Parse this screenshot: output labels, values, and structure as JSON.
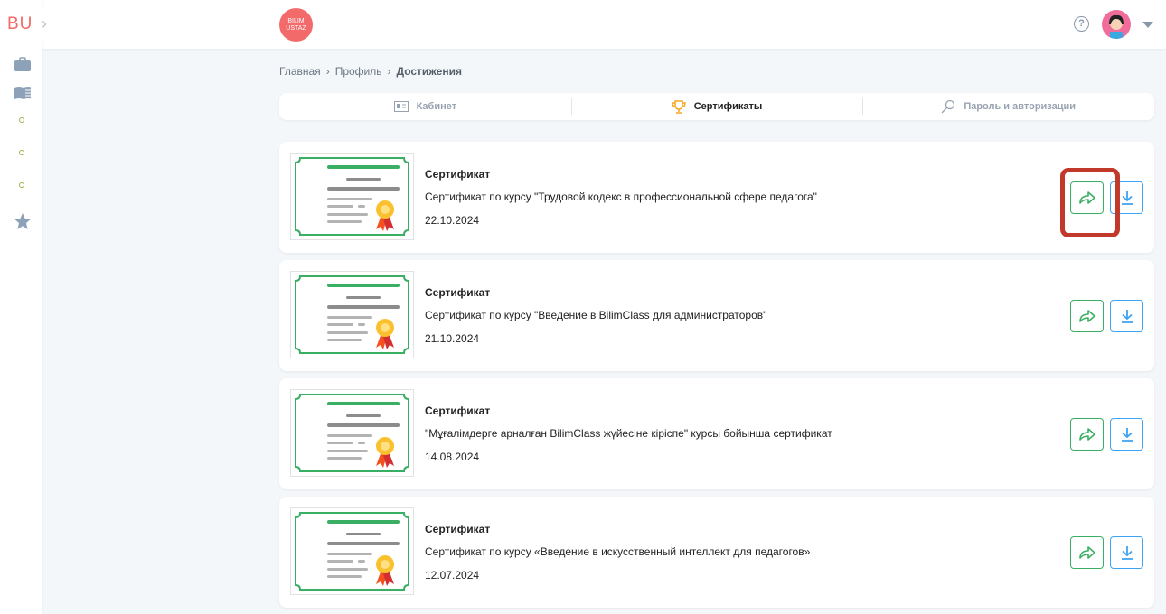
{
  "sidebar": {
    "logo": "BU",
    "expand": "›"
  },
  "header": {
    "brand_line1": "BILIM",
    "brand_line2": "USTAZ",
    "help": "?"
  },
  "breadcrumb": [
    "Главная",
    "Профиль",
    "Достижения"
  ],
  "breadcrumb_sep": "›",
  "tabs": [
    {
      "label": "Кабинет"
    },
    {
      "label": "Сертификаты"
    },
    {
      "label": "Пароль и авторизации"
    }
  ],
  "certificates": [
    {
      "title": "Сертификат",
      "description": "Сертификат по курсу \"Трудовой кодекс в профессиональной сфере педагога\"",
      "date": "22.10.2024"
    },
    {
      "title": "Сертификат",
      "description": "Сертификат по курсу \"Введение в BilimClass для администраторов\"",
      "date": "21.10.2024"
    },
    {
      "title": "Сертификат",
      "description": "\"Мұғалімдерге арналған BilimClass жүйесіне кіріспе\" курсы бойынша сертификат",
      "date": "14.08.2024"
    },
    {
      "title": "Сертификат",
      "description": "Сертификат по курсу «Введение в искусственный интеллект для педагогов»",
      "date": "12.07.2024"
    }
  ],
  "colors": {
    "brand": "#f26a6a",
    "share": "#3aae62",
    "download": "#3ea3f0",
    "highlight": "#c0392b"
  }
}
